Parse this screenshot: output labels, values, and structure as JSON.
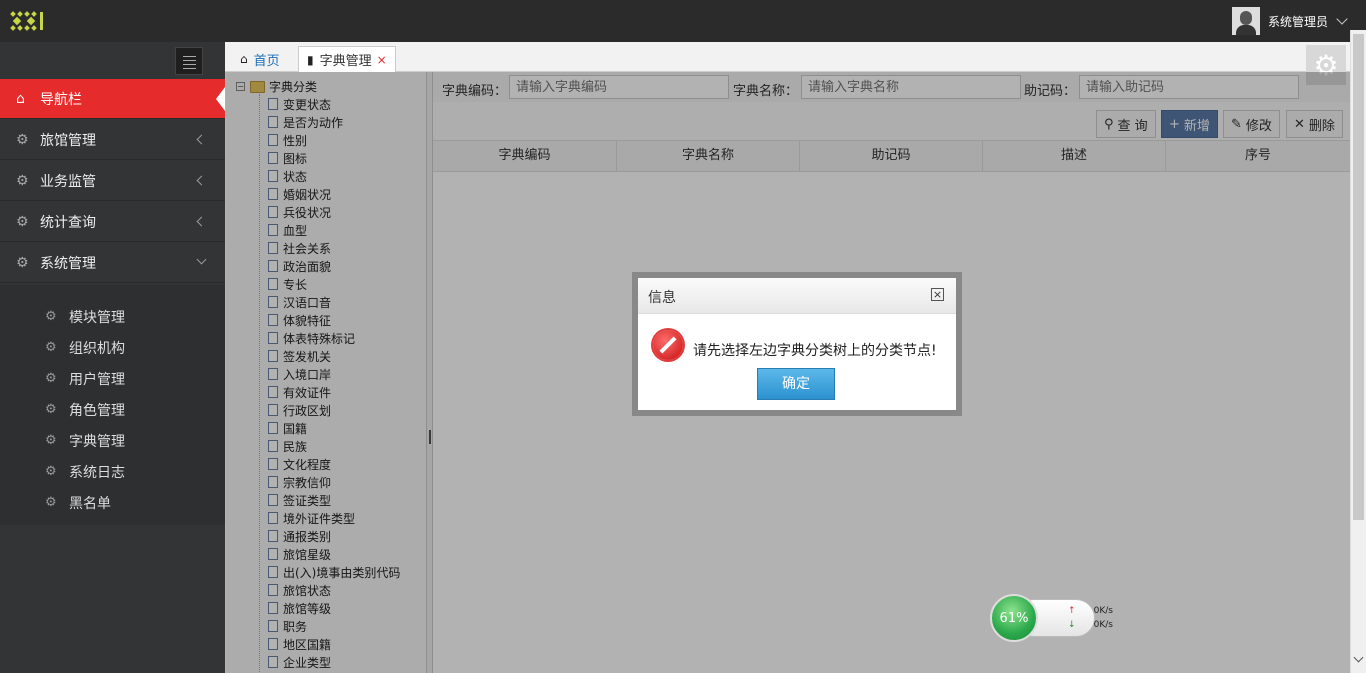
{
  "topbar": {
    "logo_icon": "app-logo",
    "user_name": "系统管理员"
  },
  "sidebar": {
    "items": [
      {
        "label": "导航栏",
        "icon": "home-icon",
        "active": true
      },
      {
        "label": "旅馆管理",
        "icon": "gears-icon"
      },
      {
        "label": "业务监管",
        "icon": "gears-icon"
      },
      {
        "label": "统计查询",
        "icon": "gears-icon"
      },
      {
        "label": "系统管理",
        "icon": "gears-icon",
        "expanded": true
      }
    ],
    "subitems": [
      {
        "label": "模块管理"
      },
      {
        "label": "组织机构"
      },
      {
        "label": "用户管理"
      },
      {
        "label": "角色管理"
      },
      {
        "label": "字典管理"
      },
      {
        "label": "系统日志"
      },
      {
        "label": "黑名单"
      }
    ],
    "accent": "#e52b2b"
  },
  "tabs": [
    {
      "label": "首页",
      "icon": "home-icon"
    },
    {
      "label": "字典管理",
      "icon": "document-icon",
      "close": "×"
    }
  ],
  "tree": {
    "root": "字典分类",
    "items": [
      "变更状态",
      "是否为动作",
      "性别",
      "图标",
      "状态",
      "婚姻状况",
      "兵役状况",
      "血型",
      "社会关系",
      "政治面貌",
      "专长",
      "汉语口音",
      "体貌特征",
      "体表特殊标记",
      "签发机关",
      "入境口岸",
      "有效证件",
      "行政区划",
      "国籍",
      "民族",
      "文化程度",
      "宗教信仰",
      "签证类型",
      "境外证件类型",
      "通报类别",
      "旅馆星级",
      "出(入)境事由类别代码",
      "旅馆状态",
      "旅馆等级",
      "职务",
      "地区国籍",
      "企业类型"
    ]
  },
  "search": {
    "code_label": "字典编码：",
    "code_placeholder": "请输入字典编码",
    "name_label": "字典名称：",
    "name_placeholder": "请输入字典名称",
    "mnemonic_label": "助记码：",
    "mnemonic_placeholder": "请输入助记码"
  },
  "toolbar": {
    "query": "查 询",
    "add": "新增",
    "edit": "修改",
    "delete": "删除"
  },
  "grid": {
    "columns": [
      "字典编码",
      "字典名称",
      "助记码",
      "描述",
      "序号"
    ]
  },
  "dialog": {
    "title": "信息",
    "close": "×",
    "message": "请先选择左边字典分类树上的分类节点!",
    "ok": "确定"
  },
  "net_widget": {
    "percent": "61%",
    "up": "0K/s",
    "down": "0K/s"
  }
}
